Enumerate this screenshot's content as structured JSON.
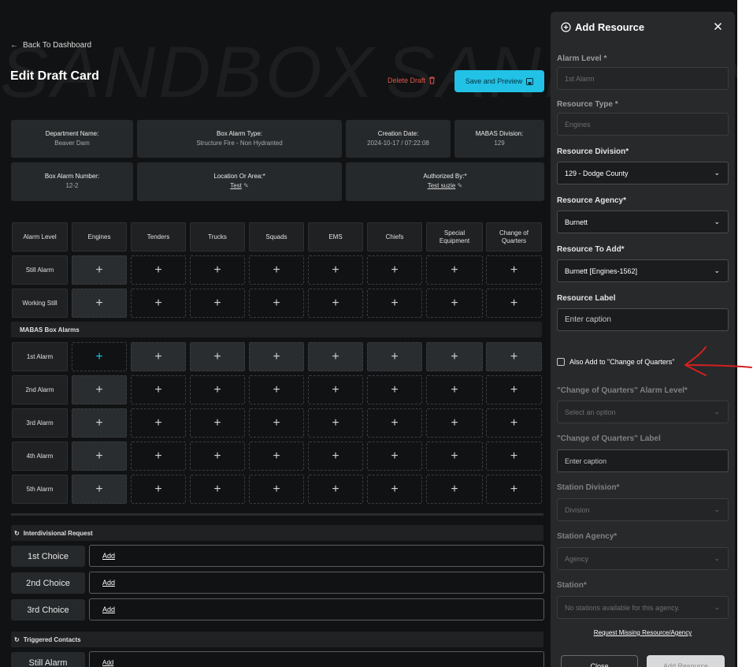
{
  "watermark": "SANDBOX",
  "nav": {
    "back_label": "Back To Dashboard"
  },
  "page": {
    "title": "Edit Draft Card",
    "delete_label": "Delete Draft",
    "save_label": "Save and Preview"
  },
  "info": {
    "department_label": "Department Name:",
    "department_value": "Beaver Dam",
    "box_type_label": "Box Alarm Type:",
    "box_type_value": "Structure Fire - Non Hydranted",
    "creation_label": "Creation Date:",
    "creation_value": "2024-10-17 / 07:22:08",
    "division_label": "MABAS Division:",
    "division_value": "129",
    "box_number_label": "Box Alarm Number:",
    "box_number_value": "12-2",
    "location_label": "Location Or Area:*",
    "location_value": "Test",
    "authorized_label": "Authorized By:*",
    "authorized_value": "Test suzie"
  },
  "grid": {
    "columns": [
      "Alarm Level",
      "Engines",
      "Tenders",
      "Trucks",
      "Squads",
      "EMS",
      "Chiefs",
      "Special Equipment",
      "Change of Quarters"
    ],
    "still_rows": [
      "Still Alarm",
      "Working Still"
    ],
    "mabas_section": "MABAS Box Alarms",
    "mabas_rows": [
      "1st Alarm",
      "2nd Alarm",
      "3rd Alarm",
      "4th Alarm",
      "5th Alarm"
    ],
    "add_glyph": "+"
  },
  "interdivisional": {
    "title": "Interdivisional Request",
    "choices": [
      "1st Choice",
      "2nd Choice",
      "3rd Choice"
    ],
    "add_label": "Add"
  },
  "triggered": {
    "title": "Triggered Contacts",
    "row_label": "Still Alarm",
    "add_label": "Add"
  },
  "sidebar": {
    "title": "Add Resource",
    "alarm_level_label": "Alarm Level *",
    "alarm_level_value": "1st Alarm",
    "resource_type_label": "Resource Type *",
    "resource_type_value": "Engines",
    "resource_division_label": "Resource Division*",
    "resource_division_value": "129 - Dodge County",
    "resource_agency_label": "Resource Agency*",
    "resource_agency_value": "Burnett",
    "resource_to_add_label": "Resource To Add*",
    "resource_to_add_value": "Burnett [Engines-1562]",
    "resource_label_label": "Resource Label",
    "resource_label_placeholder": "Enter caption",
    "also_add_label": "Also Add to \"Change of Quarters\"",
    "coq_alarm_level_label": "\"Change of Quarters\" Alarm Level*",
    "coq_alarm_level_placeholder": "Select an option",
    "coq_label_label": "\"Change of Quarters\" Label",
    "coq_label_placeholder": "Enter caption",
    "station_division_label": "Station Division*",
    "station_division_placeholder": "Division",
    "station_agency_label": "Station Agency*",
    "station_agency_placeholder": "Agency",
    "station_label": "Station*",
    "station_placeholder": "No stations available for this agency.",
    "request_missing": "Request Missing Resource/Agency",
    "close_button": "Close",
    "add_button": "Add Resource"
  },
  "colors": {
    "accent": "#22c1e6",
    "danger": "#e2574c",
    "annotation": "#d42020"
  }
}
